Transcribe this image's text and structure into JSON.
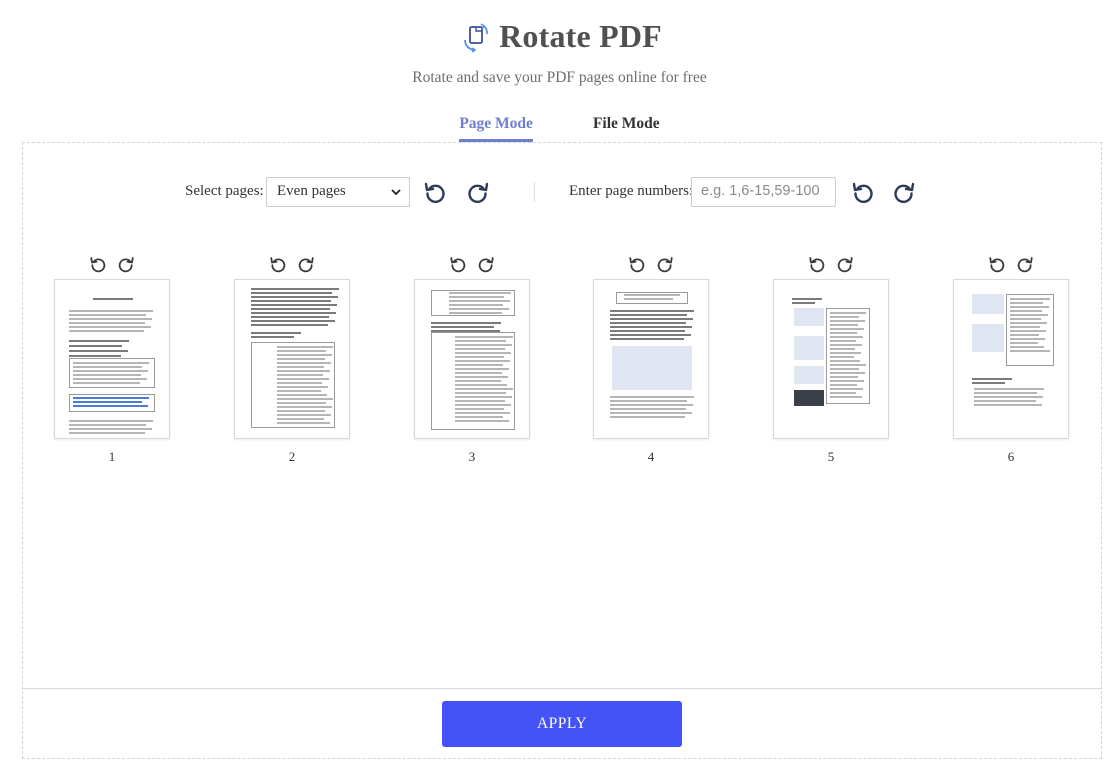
{
  "header": {
    "title": "Rotate PDF",
    "subtitle": "Rotate and save your PDF pages online for free",
    "icon": "rotate-pdf-icon"
  },
  "tabs": [
    {
      "label": "Page Mode",
      "active": true
    },
    {
      "label": "File Mode",
      "active": false
    }
  ],
  "controls": {
    "select_label": "Select pages:",
    "select_value": "Even pages",
    "page_numbers_label": "Enter page numbers:",
    "page_numbers_placeholder": "e.g. 1,6-15,59-100"
  },
  "pages": [
    {
      "number": "1"
    },
    {
      "number": "2"
    },
    {
      "number": "3"
    },
    {
      "number": "4"
    },
    {
      "number": "5"
    },
    {
      "number": "6"
    }
  ],
  "apply_label": "APPLY",
  "colors": {
    "accent": "#6f7fd0",
    "button": "#4353f5",
    "icon": "#2d3a5a"
  }
}
